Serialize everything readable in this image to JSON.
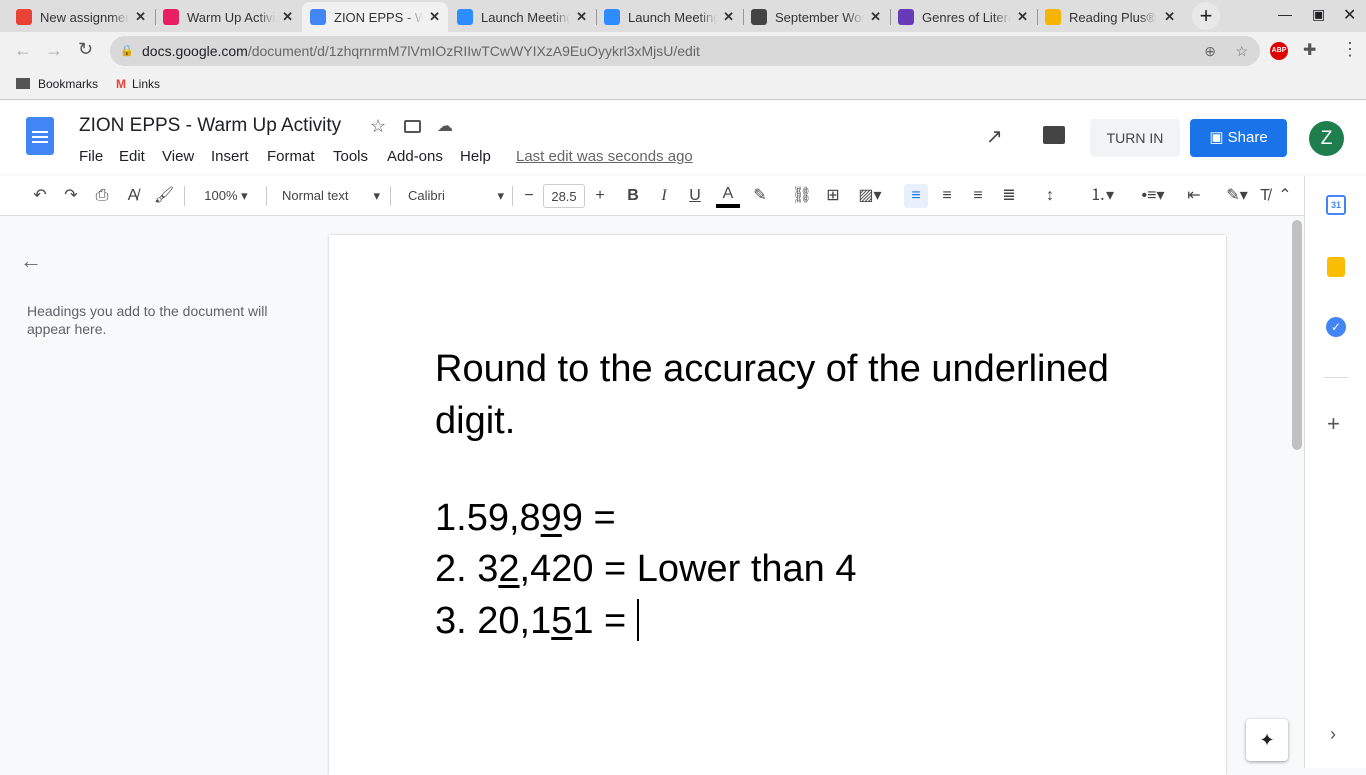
{
  "browser": {
    "tabs": [
      {
        "title": "New assignment",
        "color": "#ea4335"
      },
      {
        "title": "Warm Up Activity",
        "color": "#e91e63"
      },
      {
        "title": "ZION EPPS - Warm Up",
        "color": "#4285f4"
      },
      {
        "title": "Launch Meeting",
        "color": "#2d8cff"
      },
      {
        "title": "Launch Meeting",
        "color": "#2d8cff"
      },
      {
        "title": "September Word",
        "color": "#444444"
      },
      {
        "title": "Genres of Literature",
        "color": "#673ab7"
      },
      {
        "title": "Reading Plus®",
        "color": "#f4b400"
      }
    ],
    "url_host": "docs.google.com",
    "url_path": "/document/d/1zhqrnrmM7lVmIOzRIIwTCwWYIXzA9EuOyykrl3xMjsU/edit",
    "bookmarks": [
      "Bookmarks",
      "Links"
    ],
    "abp": "ABP"
  },
  "doc": {
    "title": "ZION EPPS - Warm Up Activity",
    "menus": [
      "File",
      "Edit",
      "View",
      "Insert",
      "Format",
      "Tools",
      "Add-ons",
      "Help"
    ],
    "last_edit": "Last edit was seconds ago",
    "turn_in": "TURN IN",
    "share": "Share",
    "avatar": "Z",
    "accent": "#1a73e8"
  },
  "toolbar": {
    "zoom": "100%",
    "style": "Normal text",
    "font": "Calibri",
    "size": "28.5"
  },
  "outline": {
    "empty": "Headings you add to the document will appear here."
  },
  "content": {
    "heading": "Round to the accuracy of the underlined digit.",
    "l1a": "1.59,8",
    "l1u": "9",
    "l1b": "9 =",
    "l2a": "2. 3",
    "l2u": "2",
    "l2b": ",420 = Lower than 4",
    "l3a": "3. 20,1",
    "l3u": "5",
    "l3b": "1 = "
  },
  "side": {
    "calendar": "31"
  }
}
